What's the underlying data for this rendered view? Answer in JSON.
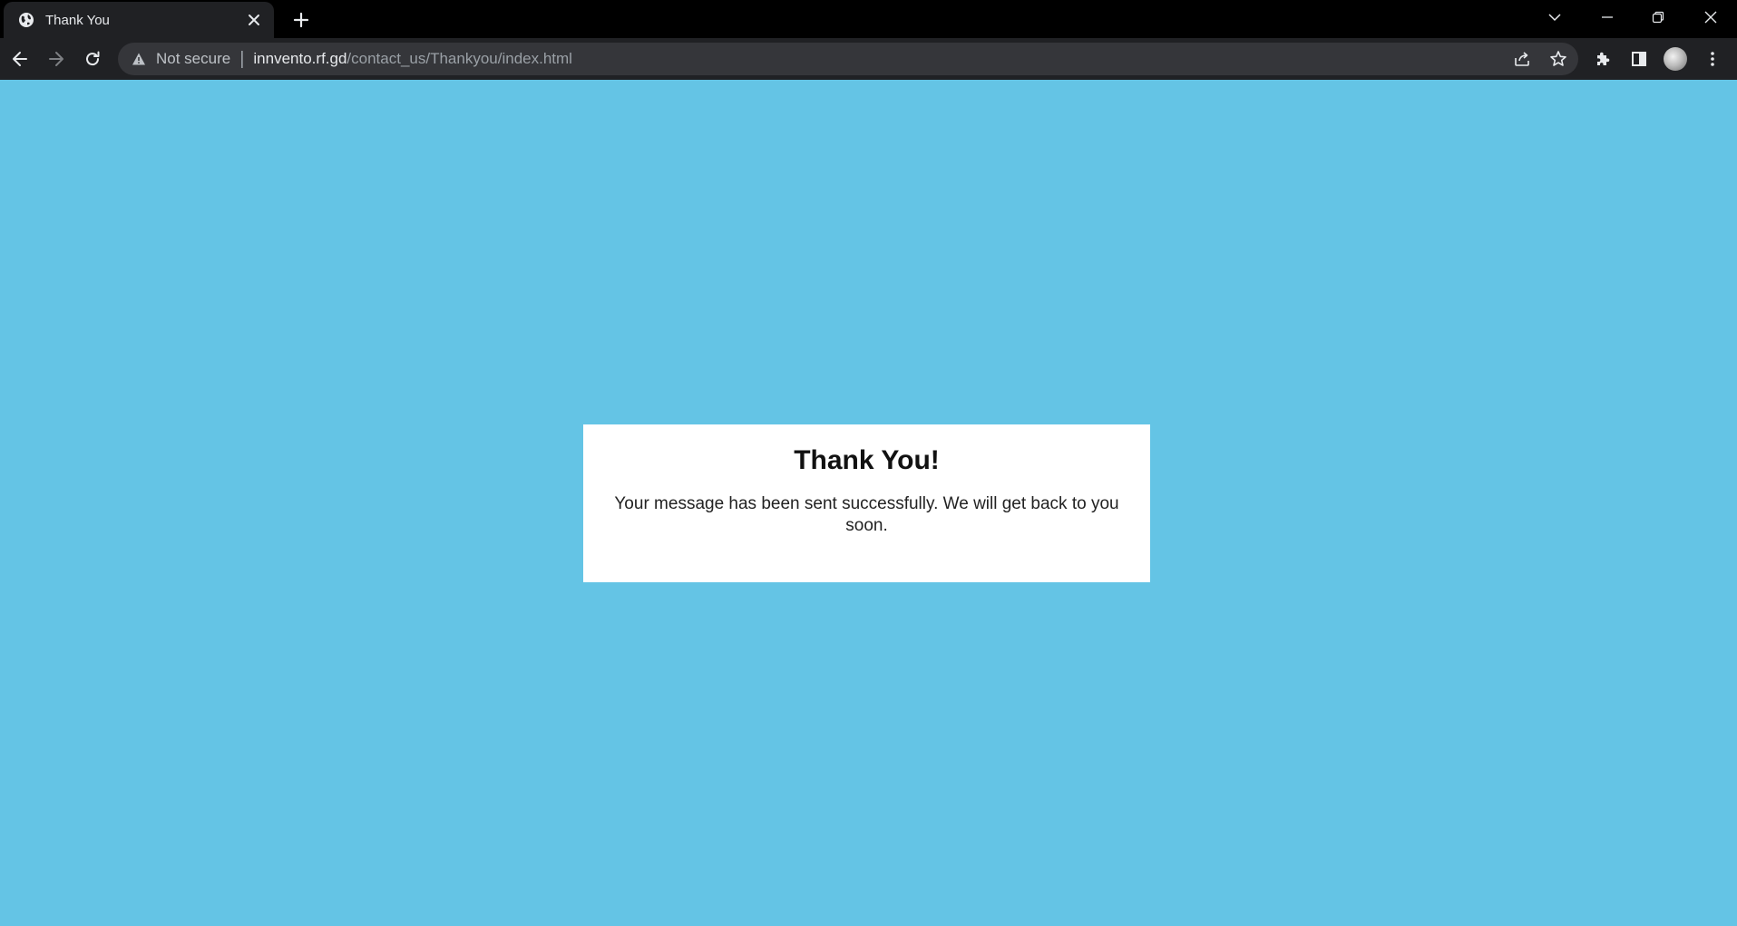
{
  "browser": {
    "tab": {
      "title": "Thank You",
      "favicon": "globe-icon"
    },
    "address_bar": {
      "security_label": "Not secure",
      "url_host": "innvento.rf.gd",
      "url_path": "/contact_us/Thankyou/index.html"
    },
    "icons": {
      "back": "back-arrow-icon",
      "forward": "forward-arrow-icon",
      "reload": "reload-icon",
      "share": "share-icon",
      "bookmark": "star-icon",
      "extensions": "puzzle-icon",
      "side_panel": "side-panel-icon",
      "menu": "kebab-menu-icon",
      "tab_search": "chevron-down-icon",
      "minimize": "minimize-icon",
      "restore": "restore-icon",
      "close": "close-icon",
      "new_tab": "plus-icon"
    },
    "colors": {
      "frame": "#000000",
      "toolbar": "#202124",
      "omnibox": "#35363a"
    }
  },
  "page": {
    "background_color": "#64c4e5",
    "card": {
      "heading": "Thank You!",
      "message": "Your message has been sent successfully. We will get back to you soon."
    }
  }
}
